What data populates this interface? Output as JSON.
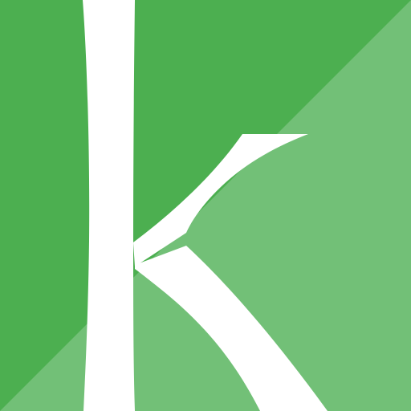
{
  "app_icon": {
    "name": "k-letter-app-icon",
    "glyph": "k",
    "colors": {
      "background_dark": "#4CAF50",
      "background_light": "#72C077",
      "glyph": "#FFFFFF"
    }
  }
}
